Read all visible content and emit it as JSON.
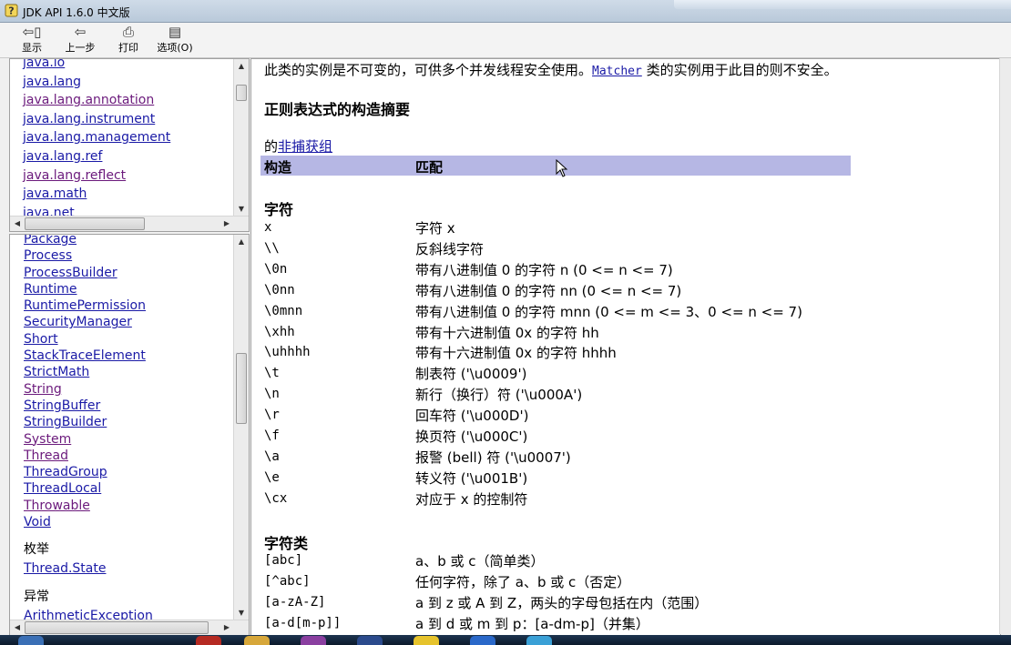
{
  "window": {
    "title": "JDK API 1.6.0 中文版"
  },
  "toolbar": {
    "buttons": [
      {
        "label": "显示",
        "icon": "⇦▯"
      },
      {
        "label": "上一步",
        "icon": "⇦"
      },
      {
        "label": "打印",
        "icon": "⎙"
      },
      {
        "label": "选项(O)",
        "icon": "▤"
      }
    ]
  },
  "packages": [
    "java.io",
    "java.lang",
    "java.lang.annotation",
    "java.lang.instrument",
    "java.lang.management",
    "java.lang.ref",
    "java.lang.reflect",
    "java.math",
    "java.net"
  ],
  "classes": {
    "items": [
      "Package",
      "Process",
      "ProcessBuilder",
      "Runtime",
      "RuntimePermission",
      "SecurityManager",
      "Short",
      "StackTraceElement",
      "StrictMath",
      "String",
      "StringBuffer",
      "StringBuilder",
      "System",
      "Thread",
      "ThreadGroup",
      "ThreadLocal",
      "Throwable",
      "Void"
    ],
    "enum_heading": "枚举",
    "enum_items": [
      "Thread.State"
    ],
    "exception_heading": "异常",
    "exception_items": [
      "ArithmeticException"
    ]
  },
  "content": {
    "intro_before": "此类的实例是不可变的，可供多个并发线程安全使用。",
    "intro_link": "Matcher",
    "intro_after": " 类的实例用于此目的则不安全。",
    "summary_title": "正则表达式的构造摘要",
    "noncap_prefix": "的",
    "noncap_link": "非捕获组",
    "table_header": {
      "col1": "构造",
      "col2": "匹配"
    },
    "section_chars": "字符",
    "char_rows": [
      {
        "construct": "x",
        "match": "字符 x"
      },
      {
        "construct": "\\\\",
        "match": "反斜线字符"
      },
      {
        "construct": "\\0n",
        "match": "带有八进制值 0 的字符 n (0 <= n <= 7)"
      },
      {
        "construct": "\\0nn",
        "match": "带有八进制值 0 的字符 nn (0 <= n <= 7)"
      },
      {
        "construct": "\\0mnn",
        "match": "带有八进制值 0 的字符 mnn (0 <= m <= 3、0 <= n <= 7)"
      },
      {
        "construct": "\\xhh",
        "match": "带有十六进制值 0x 的字符 hh"
      },
      {
        "construct": "\\uhhhh",
        "match": "带有十六进制值 0x 的字符 hhhh"
      },
      {
        "construct": "\\t",
        "match": "制表符 ('\\u0009')"
      },
      {
        "construct": "\\n",
        "match": "新行（换行）符 ('\\u000A')"
      },
      {
        "construct": "\\r",
        "match": "回车符 ('\\u000D')"
      },
      {
        "construct": "\\f",
        "match": "换页符 ('\\u000C')"
      },
      {
        "construct": "\\a",
        "match": "报警 (bell) 符 ('\\u0007')"
      },
      {
        "construct": "\\e",
        "match": "转义符 ('\\u001B')"
      },
      {
        "construct": "\\cx",
        "match": "对应于 x 的控制符"
      }
    ],
    "section_classes": "字符类",
    "class_rows": [
      {
        "construct": "[abc]",
        "match": "a、b 或 c（简单类）"
      },
      {
        "construct": "[^abc]",
        "match": "任何字符，除了 a、b 或 c（否定）"
      },
      {
        "construct": "[a-zA-Z]",
        "match": "a 到 z 或 A 到 Z，两头的字母包括在内（范围）"
      },
      {
        "construct": "[a-d[m-p]]",
        "match": "a 到 d 或 m 到 p：[a-dm-p]（并集）"
      }
    ]
  }
}
